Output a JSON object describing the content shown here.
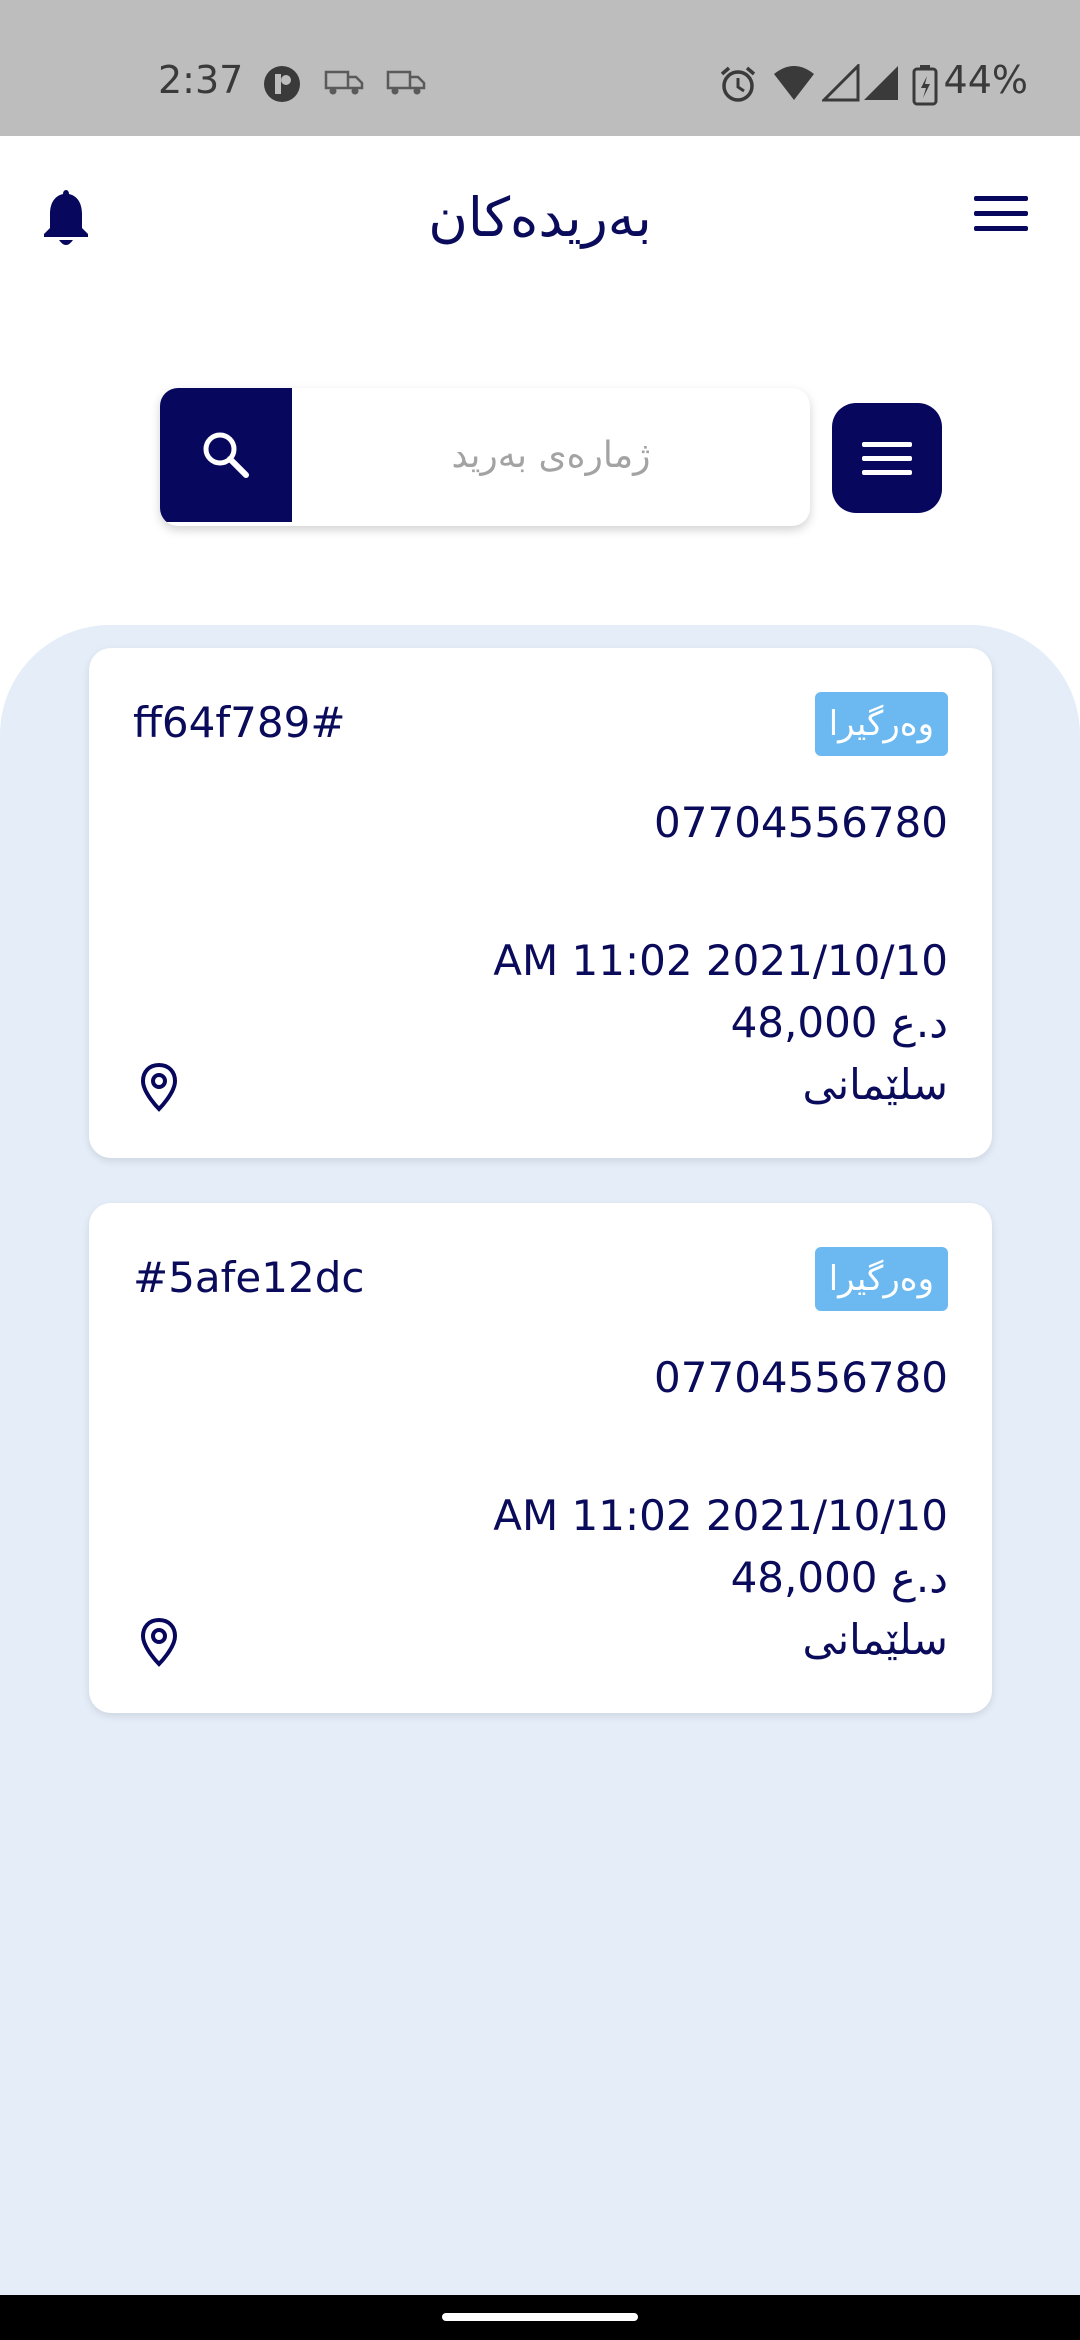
{
  "status_bar": {
    "time": "2:37",
    "battery": "44%"
  },
  "app_bar": {
    "title": "بەریدەکان",
    "bell_icon": "bell-icon",
    "menu_icon": "menu-icon"
  },
  "search": {
    "placeholder": "ژمارەی بەرید",
    "search_icon": "search-icon",
    "filter_icon": "filter-menu-icon"
  },
  "orders": [
    {
      "code": "ff64f789#",
      "status": "وەرگیرا",
      "phone": "07704556780",
      "datetime": "AM 11:02 2021/10/10",
      "price": "48,000 د.ع",
      "city": "سلێمانی"
    },
    {
      "code": "#5afe12dc",
      "status": "وەرگیرا",
      "phone": "07704556780",
      "datetime": "AM 11:02 2021/10/10",
      "price": "48,000 د.ع",
      "city": "سلێمانی"
    }
  ],
  "colors": {
    "primary": "#07075e",
    "badge": "#6bb9f0",
    "list_background": "#e4edf8"
  }
}
